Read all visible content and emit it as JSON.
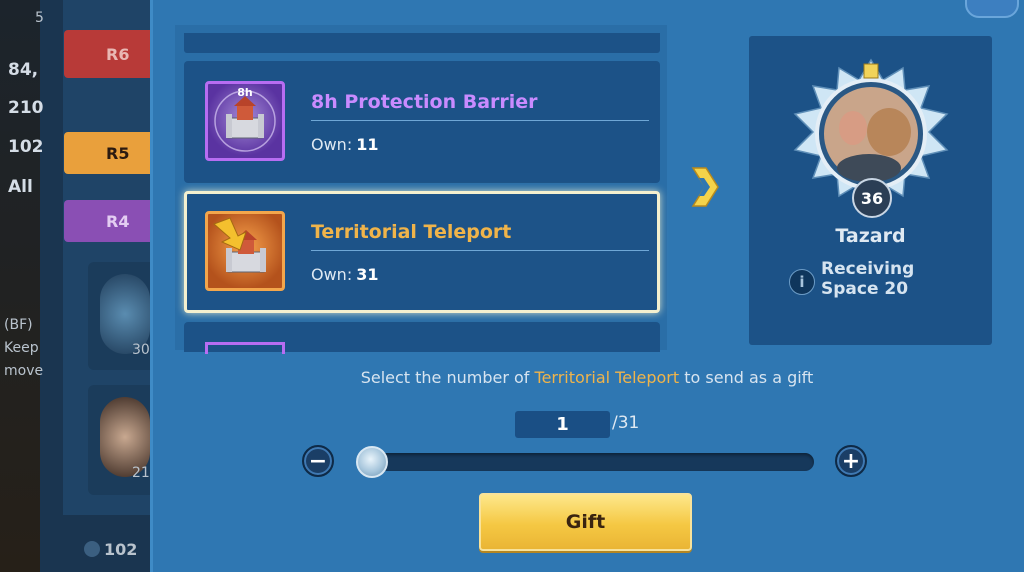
{
  "background": {
    "left_values": [
      "84,",
      "210",
      "102",
      "All"
    ],
    "partial_number": "5",
    "ranks": [
      "R6",
      "R5",
      "R4"
    ],
    "side_text": [
      "(BF)",
      "Keep",
      "move"
    ],
    "card_numbers": [
      "30",
      "21"
    ],
    "footer_value": "102"
  },
  "items": [
    {
      "title": "8h Protection Barrier",
      "own_label": "Own:",
      "own_value": "11",
      "icon": "protection-barrier-icon",
      "icon_text": "8h",
      "title_color": "#c98bff"
    },
    {
      "title": "Territorial Teleport",
      "own_label": "Own:",
      "own_value": "31",
      "icon": "territorial-teleport-icon",
      "title_color": "#f0b44a"
    }
  ],
  "recipient": {
    "name": "Tazard",
    "level": "36",
    "status_line1": "Receiving",
    "status_line2": "Space 20"
  },
  "instruction": {
    "prefix": "Select the number of",
    "item": "Territorial Teleport",
    "suffix": "to send as a gift"
  },
  "quantity": {
    "value": "1",
    "max": "/31",
    "slider_fraction": 0.0
  },
  "gift_button": "Gift",
  "colors": {
    "modal": "#2f77b2",
    "card": "#1c5287",
    "accent_orange": "#f0b44a",
    "accent_purple": "#c98bff",
    "gift_yellow": "#f5c843"
  }
}
